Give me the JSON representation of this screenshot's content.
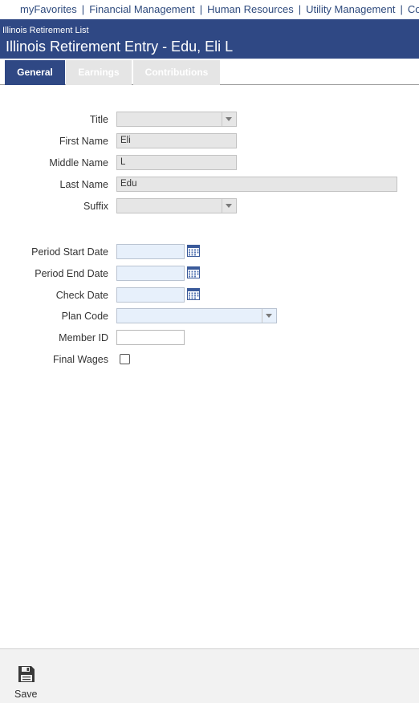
{
  "topnav": {
    "items": [
      "myFavorites",
      "Financial Management",
      "Human Resources",
      "Utility Management",
      "Co"
    ],
    "separator": "|"
  },
  "header": {
    "breadcrumb": "Illinois Retirement List",
    "title": "Illinois Retirement Entry - Edu, Eli L"
  },
  "tabs": [
    "General",
    "Earnings",
    "Contributions"
  ],
  "form": {
    "title": {
      "label": "Title",
      "value": ""
    },
    "first_name": {
      "label": "First Name",
      "value": "Eli"
    },
    "middle_name": {
      "label": "Middle Name",
      "value": "L"
    },
    "last_name": {
      "label": "Last Name",
      "value": "Edu"
    },
    "suffix": {
      "label": "Suffix",
      "value": ""
    },
    "period_start_date": {
      "label": "Period Start Date",
      "value": ""
    },
    "period_end_date": {
      "label": "Period End Date",
      "value": ""
    },
    "check_date": {
      "label": "Check Date",
      "value": ""
    },
    "plan_code": {
      "label": "Plan Code",
      "value": ""
    },
    "member_id": {
      "label": "Member ID",
      "value": ""
    },
    "final_wages": {
      "label": "Final Wages",
      "checked": false
    }
  },
  "footer": {
    "save_label": "Save"
  },
  "icons": {
    "save": "floppy-disk-icon",
    "calendar": "calendar-icon",
    "dropdown": "chevron-down-icon"
  },
  "colors": {
    "header_bg": "#2f4884",
    "nav_link": "#2e4a7d",
    "readonly_field": "#e6e6e6",
    "date_field": "#e7f0fb"
  }
}
